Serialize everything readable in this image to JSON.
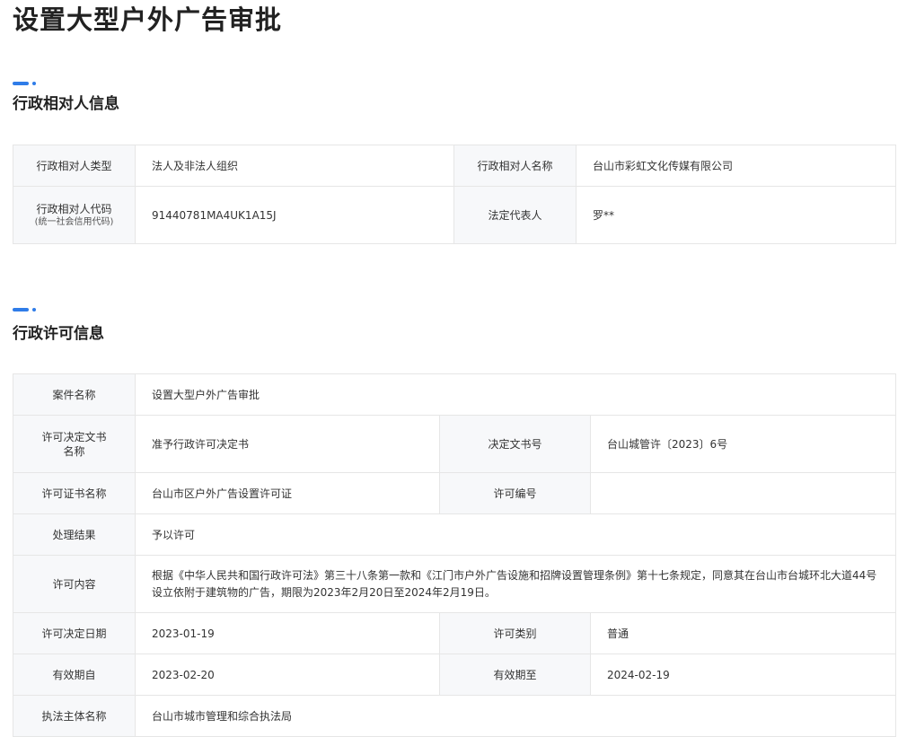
{
  "page": {
    "title": "设置大型户外广告审批"
  },
  "party_section": {
    "title": "行政相对人信息",
    "rows": [
      {
        "l1": "行政相对人类型",
        "v1": "法人及非法人组织",
        "l2": "行政相对人名称",
        "v2": "台山市彩虹文化传媒有限公司"
      },
      {
        "l1": "行政相对人代码",
        "l1_sub": "(统一社会信用代码)",
        "v1": "91440781MA4UK1A15J",
        "l2": "法定代表人",
        "v2": "罗**"
      }
    ]
  },
  "permit_section": {
    "title": "行政许可信息",
    "case_name_label": "案件名称",
    "case_name": "设置大型户外广告审批",
    "decision_doc_name_label": "许可决定文书名称",
    "decision_doc_name": "准予行政许可决定书",
    "decision_doc_no_label": "决定文书号",
    "decision_doc_no": "台山城管许〔2023〕6号",
    "cert_name_label": "许可证书名称",
    "cert_name": "台山市区户外广告设置许可证",
    "permit_no_label": "许可编号",
    "permit_no": "",
    "result_label": "处理结果",
    "result": "予以许可",
    "content_label": "许可内容",
    "content": "根据《中华人民共和国行政许可法》第三十八条第一款和《江门市户外广告设施和招牌设置管理条例》第十七条规定，同意其在台山市台城环北大道44号设立依附于建筑物的广告，期限为2023年2月20日至2024年2月19日。",
    "decision_date_label": "许可决定日期",
    "decision_date": "2023-01-19",
    "category_label": "许可类别",
    "category": "普通",
    "valid_from_label": "有效期自",
    "valid_from": "2023-02-20",
    "valid_to_label": "有效期至",
    "valid_to": "2024-02-19",
    "authority_label": "执法主体名称",
    "authority": "台山市城市管理和综合执法局"
  },
  "colors": {
    "accent": "#2f7ce8",
    "label_bg": "#f7f8fa",
    "border": "#e6e6e6"
  }
}
